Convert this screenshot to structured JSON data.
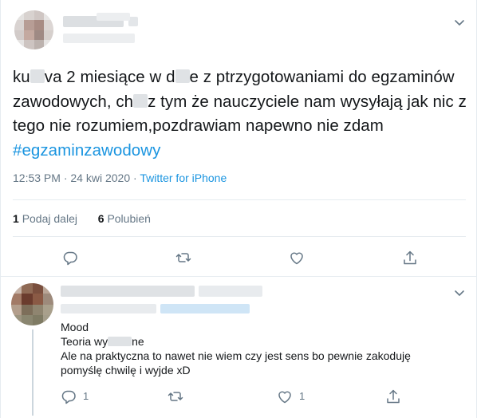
{
  "tweet": {
    "text_part1": "ku",
    "text_part2": "va 2 miesiące w d",
    "text_part3": "e z ptrzygotowaniami do egzaminów zawodowych, ch",
    "text_part4": "z tym że nauczyciele nam wysyłają jak nic z tego nie rozumiem,pozdrawiam napewno nie zdam ",
    "hashtag": "#egzaminzawodowy",
    "time": "12:53 PM",
    "sep": " · ",
    "date": "24 kwi 2020",
    "source": "Twitter for iPhone",
    "retweet_count": "1",
    "retweet_label": "Podaj dalej",
    "like_count": "6",
    "like_label": "Polubień"
  },
  "reply": {
    "line1": "Mood",
    "line2a": "Teoria wy",
    "line2b": "ne",
    "line3": "Ale na praktyczna to nawet nie wiem czy jest sens bo pewnie zakoduję",
    "line4": "pomyślę chwilę i wyjde xD",
    "reply_count": "1",
    "like_count": "1"
  },
  "icons": [
    "chevron-down-icon",
    "reply-icon",
    "retweet-icon",
    "like-icon",
    "share-icon"
  ],
  "colors": {
    "accent": "#1b95e0",
    "muted": "#657786",
    "text": "#14171a",
    "border": "#e6ecf0"
  }
}
